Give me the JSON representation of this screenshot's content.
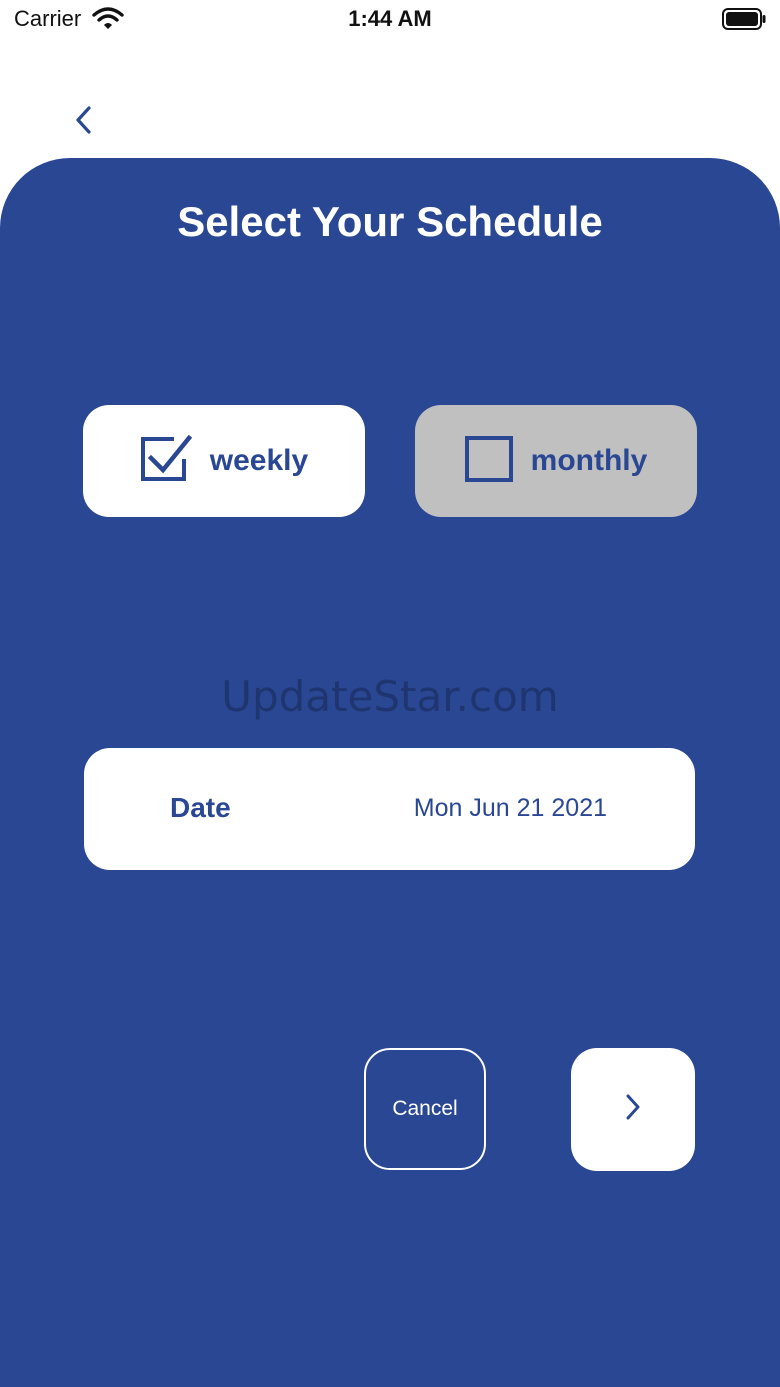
{
  "status_bar": {
    "carrier": "Carrier",
    "time": "1:44 AM",
    "wifi_icon": "wifi-icon",
    "battery_icon": "battery-icon"
  },
  "nav": {
    "back_icon": "chevron-left-icon"
  },
  "title": "Select Your Schedule",
  "options": [
    {
      "label": "weekly",
      "checked": true,
      "icon": "checkbox-checked-icon"
    },
    {
      "label": "monthly",
      "checked": false,
      "icon": "checkbox-empty-icon"
    }
  ],
  "watermark": "UpdateStar.com",
  "date_field": {
    "label": "Date",
    "value": "Mon Jun 21 2021"
  },
  "actions": {
    "cancel_label": "Cancel",
    "next_icon": "chevron-right-icon"
  },
  "colors": {
    "primary": "#2a4794",
    "selected_bg": "#ffffff",
    "unselected_bg": "#c0c0c0",
    "text_on_primary": "#ffffff"
  }
}
